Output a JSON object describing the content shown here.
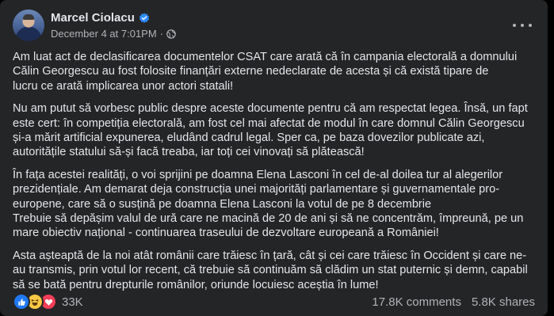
{
  "post": {
    "author": "Marcel Ciolacu",
    "timestamp": "December 4 at 7:01PM",
    "separator": "·",
    "paragraphs": [
      {
        "lines": [
          "Am luat act de declasificarea documentelor CSAT care arată că în campania electorală a domnului",
          "Călin Georgescu au fost folosite finanțări externe nedeclarate de acesta și că există tipare de",
          "lucru ce arată implicarea unor actori statali!"
        ]
      },
      {
        "lines": [
          "Nu am putut să vorbesc public despre aceste documente pentru că am respectat legea. Însă, un fapt",
          "este cert: în competiția electorală, am fost cel mai afectat de modul în care domnul Călin Georgescu",
          "și-a mărit artificial expunerea, eludând cadrul legal. Sper ca, pe baza dovezilor publicate azi,",
          "autoritățile statului să-și facă treaba, iar toți cei vinovați să plătească!"
        ]
      },
      {
        "lines": [
          "În fața acestei realități, o voi sprijini pe doamna Elena Lasconi în cel de-al doilea tur al alegerilor",
          "prezidențiale. Am demarat deja construcția unei majorități parlamentare și guvernamentale pro-",
          "europene, care să o susțină pe doamna Elena Lasconi la votul de pe 8 decembrie",
          "Trebuie să depășim valul de ură care ne macină de 20 de ani și să ne concentrăm, împreună, pe un",
          "mare obiectiv național - continuarea traseului de dezvoltare europeană a României!"
        ]
      },
      {
        "lines": [
          "Asta așteaptă de la noi atât românii care trăiesc în țară, cât și cei care trăiesc în Occident și care ne-",
          "au transmis, prin votul lor recent, că trebuie să continuăm să clădim un stat puternic și demn, capabil",
          "să se bată pentru drepturile românilor, oriunde locuiesc aceștia în lume!"
        ]
      }
    ],
    "reaction_count": "33K",
    "comments": "17.8K comments",
    "shares": "5.8K shares"
  },
  "icons": {
    "verified": "verified-badge-icon",
    "privacy": "globe-icon",
    "more": "more-options-icon",
    "reactions": [
      "like-icon",
      "haha-icon",
      "love-icon"
    ]
  },
  "colors": {
    "card_bg": "#242526",
    "page_bg": "#000000",
    "primary_text": "#e4e6eb",
    "secondary_text": "#b0b3b8",
    "verified_blue": "#2d88ff",
    "like_blue": "#2078f4",
    "haha_yellow": "#f7c844",
    "love_red": "#f33e58"
  }
}
